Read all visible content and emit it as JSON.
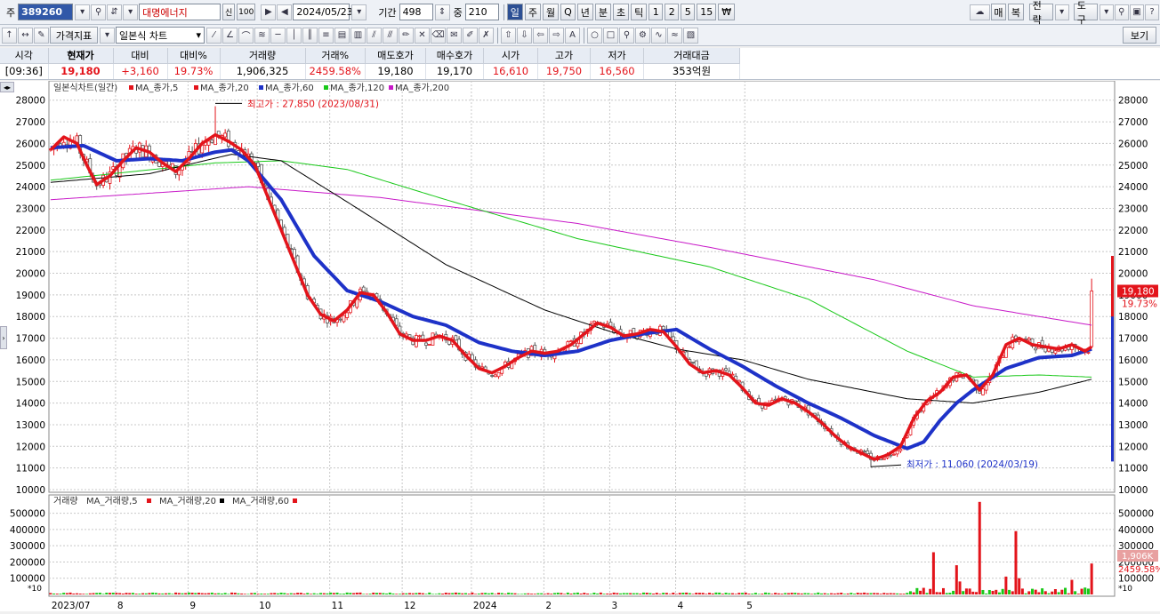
{
  "toolbar1": {
    "market_label": "주",
    "code": "389260",
    "stock_name": "대명에너지",
    "credit_tag": "신",
    "credit_rate": "100",
    "date": "2024/05/23",
    "period_label": "기간",
    "period_value": "498",
    "overlap_label": "중",
    "overlap_value": "210",
    "intervals": [
      "일",
      "주",
      "월",
      "Q",
      "년",
      "분",
      "초",
      "틱",
      "1",
      "2",
      "5",
      "15",
      "₩"
    ],
    "selected_interval": "일",
    "right_buttons": [
      "매",
      "복",
      "전략",
      "도구"
    ]
  },
  "toolbar2": {
    "price_indicator": "가격지표",
    "chart_type": "일본식 차트",
    "view_label": "보기"
  },
  "quote": {
    "headers": [
      "시각",
      "현재가",
      "대비",
      "대비%",
      "거래량",
      "거래%",
      "매도호가",
      "매수호가",
      "시가",
      "고가",
      "저가",
      "거래대금"
    ],
    "values": [
      "[09:36]",
      "19,180",
      "+3,160",
      "19.73%",
      "1,906,325",
      "2459.58%",
      "19,180",
      "19,170",
      "16,610",
      "19,750",
      "16,560",
      "353억원"
    ]
  },
  "chart_data": {
    "type": "candlestick",
    "title": "일본식차트(일간)",
    "legend": [
      {
        "name": "MA_종가,5",
        "color": "#e3141b"
      },
      {
        "name": "MA_종가,20",
        "color": "#e3141b"
      },
      {
        "name": "MA_종가,60",
        "color": "#1e32c8"
      },
      {
        "name": "MA_종가,120",
        "color": "#19c819"
      },
      {
        "name": "MA_종가,200",
        "color": "#c819c8"
      }
    ],
    "y_ticks": [
      28000,
      27000,
      26000,
      25000,
      24000,
      23000,
      22000,
      21000,
      20000,
      19000,
      18000,
      17000,
      16000,
      15000,
      14000,
      13000,
      12000,
      11000,
      10000
    ],
    "y_tick_labels": [
      "28000",
      "27000",
      "26000",
      "25000",
      "24000",
      "23000",
      "22000",
      "21000",
      "20000",
      "19000",
      "18000",
      "17000",
      "16000",
      "15000",
      "14000",
      "13000",
      "12000",
      "11000",
      "10000"
    ],
    "ylim": [
      10000,
      28400
    ],
    "x_labels": [
      "2023/07",
      "8",
      "9",
      "10",
      "11",
      "12",
      "2024",
      "2",
      "3",
      "4",
      "5"
    ],
    "annotations": {
      "high": "최고가 : 27,850 (2023/08/31)",
      "low": "최저가 : 11,060 (2024/03/19)"
    },
    "current_price_label": "19,180",
    "current_change_label": "19.73%",
    "ma5": [
      [
        0,
        25700
      ],
      [
        4,
        26300
      ],
      [
        8,
        26000
      ],
      [
        11,
        25000
      ],
      [
        14,
        24100
      ],
      [
        18,
        24500
      ],
      [
        22,
        25200
      ],
      [
        26,
        25800
      ],
      [
        30,
        25600
      ],
      [
        34,
        25100
      ],
      [
        38,
        24700
      ],
      [
        42,
        25300
      ],
      [
        46,
        26000
      ],
      [
        50,
        26400
      ],
      [
        54,
        26100
      ],
      [
        58,
        25700
      ],
      [
        62,
        25000
      ],
      [
        66,
        23500
      ],
      [
        70,
        22000
      ],
      [
        74,
        20500
      ],
      [
        78,
        19000
      ],
      [
        82,
        18100
      ],
      [
        86,
        17800
      ],
      [
        90,
        18300
      ],
      [
        94,
        19100
      ],
      [
        98,
        19000
      ],
      [
        102,
        18200
      ],
      [
        106,
        17200
      ],
      [
        110,
        16900
      ],
      [
        114,
        16900
      ],
      [
        118,
        17100
      ],
      [
        122,
        16900
      ],
      [
        126,
        16200
      ],
      [
        130,
        15600
      ],
      [
        134,
        15400
      ],
      [
        138,
        15700
      ],
      [
        142,
        16100
      ],
      [
        146,
        16400
      ],
      [
        150,
        16300
      ],
      [
        154,
        16400
      ],
      [
        158,
        16700
      ],
      [
        162,
        17200
      ],
      [
        166,
        17700
      ],
      [
        170,
        17500
      ],
      [
        174,
        17100
      ],
      [
        178,
        17200
      ],
      [
        182,
        17400
      ],
      [
        186,
        17300
      ],
      [
        190,
        16600
      ],
      [
        194,
        15800
      ],
      [
        198,
        15400
      ],
      [
        202,
        15500
      ],
      [
        206,
        15300
      ],
      [
        210,
        14700
      ],
      [
        214,
        14000
      ],
      [
        218,
        13900
      ],
      [
        222,
        14200
      ],
      [
        226,
        14000
      ],
      [
        230,
        13600
      ],
      [
        234,
        13100
      ],
      [
        238,
        12500
      ],
      [
        242,
        12000
      ],
      [
        246,
        11700
      ],
      [
        250,
        11400
      ],
      [
        254,
        11600
      ],
      [
        258,
        12000
      ],
      [
        262,
        13300
      ],
      [
        266,
        14100
      ],
      [
        270,
        14500
      ],
      [
        274,
        15200
      ],
      [
        278,
        15300
      ],
      [
        282,
        14600
      ],
      [
        286,
        15300
      ],
      [
        290,
        16700
      ],
      [
        294,
        17000
      ],
      [
        298,
        16700
      ],
      [
        302,
        16600
      ],
      [
        306,
        16500
      ],
      [
        310,
        16700
      ],
      [
        314,
        16400
      ],
      [
        316,
        16600
      ]
    ],
    "ma20": [
      [
        0,
        25800
      ],
      [
        10,
        25900
      ],
      [
        20,
        25200
      ],
      [
        30,
        25300
      ],
      [
        40,
        25200
      ],
      [
        50,
        25600
      ],
      [
        55,
        25700
      ],
      [
        60,
        25200
      ],
      [
        70,
        23400
      ],
      [
        80,
        20800
      ],
      [
        90,
        19200
      ],
      [
        100,
        18700
      ],
      [
        110,
        18000
      ],
      [
        120,
        17600
      ],
      [
        130,
        16800
      ],
      [
        140,
        16400
      ],
      [
        150,
        16200
      ],
      [
        160,
        16400
      ],
      [
        170,
        16900
      ],
      [
        180,
        17200
      ],
      [
        190,
        17400
      ],
      [
        200,
        16500
      ],
      [
        210,
        15700
      ],
      [
        220,
        14800
      ],
      [
        230,
        14000
      ],
      [
        240,
        13300
      ],
      [
        250,
        12500
      ],
      [
        260,
        11900
      ],
      [
        265,
        12200
      ],
      [
        270,
        13200
      ],
      [
        275,
        14000
      ],
      [
        280,
        14600
      ],
      [
        290,
        15600
      ],
      [
        300,
        16100
      ],
      [
        310,
        16200
      ],
      [
        316,
        16500
      ]
    ],
    "ma60": [
      [
        0,
        24200
      ],
      [
        30,
        24600
      ],
      [
        55,
        25500
      ],
      [
        70,
        25200
      ],
      [
        90,
        23300
      ],
      [
        120,
        20400
      ],
      [
        150,
        18300
      ],
      [
        170,
        17300
      ],
      [
        190,
        16500
      ],
      [
        210,
        16000
      ],
      [
        230,
        15100
      ],
      [
        250,
        14500
      ],
      [
        260,
        14200
      ],
      [
        270,
        14100
      ],
      [
        280,
        14000
      ],
      [
        300,
        14500
      ],
      [
        316,
        15100
      ]
    ],
    "ma120": [
      [
        0,
        24300
      ],
      [
        50,
        25100
      ],
      [
        70,
        25200
      ],
      [
        90,
        24800
      ],
      [
        120,
        23400
      ],
      [
        160,
        21600
      ],
      [
        200,
        20300
      ],
      [
        230,
        18800
      ],
      [
        260,
        16400
      ],
      [
        280,
        15200
      ],
      [
        300,
        15300
      ],
      [
        316,
        15200
      ]
    ],
    "ma200": [
      [
        0,
        23400
      ],
      [
        60,
        24000
      ],
      [
        100,
        23500
      ],
      [
        160,
        22300
      ],
      [
        200,
        21200
      ],
      [
        250,
        19700
      ],
      [
        280,
        18500
      ],
      [
        316,
        17600
      ]
    ],
    "volume": {
      "title": "거래량",
      "legend": [
        {
          "name": "MA_거래량,5",
          "color": "#e3141b"
        },
        {
          "name": "MA_거래량,20",
          "color": "#000000"
        },
        {
          "name": "MA_거래량,60",
          "color": "#e3141b"
        }
      ],
      "y_tick_labels": [
        "500000",
        "400000",
        "300000",
        "200000",
        "100000"
      ],
      "y_ticks": [
        500000,
        400000,
        300000,
        200000,
        100000
      ],
      "ylim": [
        0,
        580000
      ],
      "scale_tag": "*10",
      "current_volume_label": "1,906K",
      "current_ratio_label": "2459.58%",
      "spikes": [
        [
          268,
          260000
        ],
        [
          275,
          180000
        ],
        [
          276,
          80000
        ],
        [
          282,
          570000
        ],
        [
          290,
          110000
        ],
        [
          293,
          390000
        ],
        [
          294,
          100000
        ],
        [
          310,
          90000
        ],
        [
          316,
          190600
        ]
      ]
    }
  }
}
